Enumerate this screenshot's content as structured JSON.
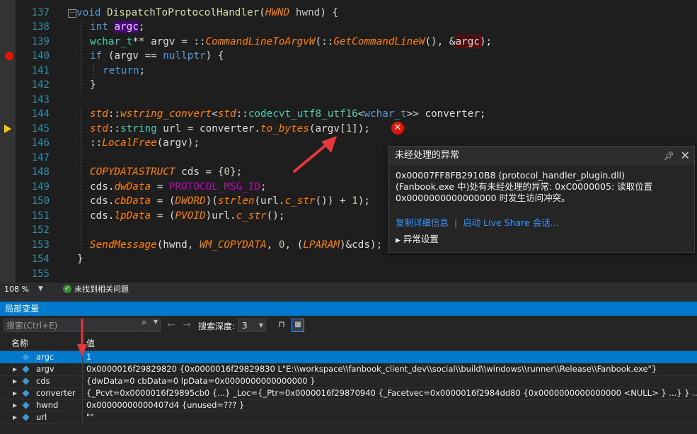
{
  "editor": {
    "line_numbers": [
      "137",
      "138",
      "139",
      "140",
      "141",
      "142",
      "143",
      "144",
      "145",
      "146",
      "147",
      "148",
      "149",
      "150",
      "151",
      "152",
      "153",
      "154",
      "155"
    ],
    "zoom": "108 %",
    "status_text": "未找到相关问题"
  },
  "exception_popup": {
    "title": "未经处理的异常",
    "message_line1": "0x00007FF8FB2910B8 (protocol_handler_plugin.dll)",
    "message_line2": "(Fanbook.exe 中)处有未经处理的异常: 0xC0000005: 读取位置",
    "message_line3": "0x0000000000000000 时发生访问冲突。",
    "link_copy": "复制详细信息",
    "link_separator": "|",
    "link_liveshare": "启动 Live Share 会话...",
    "settings_label": "异常设置",
    "pin_icon": "pin-icon",
    "close_icon": "close-icon"
  },
  "locals_panel": {
    "title": "局部变量",
    "search_placeholder": "搜索(Ctrl+E)",
    "depth_label": "搜索深度:",
    "depth_value": "3",
    "col_name": "名称",
    "col_value": "值",
    "rows": [
      {
        "name": "argc",
        "value": "1"
      },
      {
        "name": "argv",
        "value": "0x0000016f29829820 {0x0000016f29829830 L\"E:\\\\workspace\\\\fanbook_client_dev\\\\social\\\\build\\\\windows\\\\runner\\\\Release\\\\Fanbook.exe\"}"
      },
      {
        "name": "cds",
        "value": "{dwData=0 cbData=0 lpData=0x0000000000000000 }"
      },
      {
        "name": "converter",
        "value": "{_Pcvt=0x0000016f29895cb0 {...} _Loc={_Ptr=0x0000016f29870940 {_Facetvec=0x0000016f2984dd80 {0x0000000000000000 <NULL> } ...} } ...}"
      },
      {
        "name": "hwnd",
        "value": "0x00000000000407d4 {unused=??? }"
      },
      {
        "name": "url",
        "value": "\"\""
      }
    ]
  },
  "colors": {
    "accent": "#007acc",
    "breakpoint": "#e51400",
    "error": "#e51400",
    "arrow": "#e8373c"
  }
}
